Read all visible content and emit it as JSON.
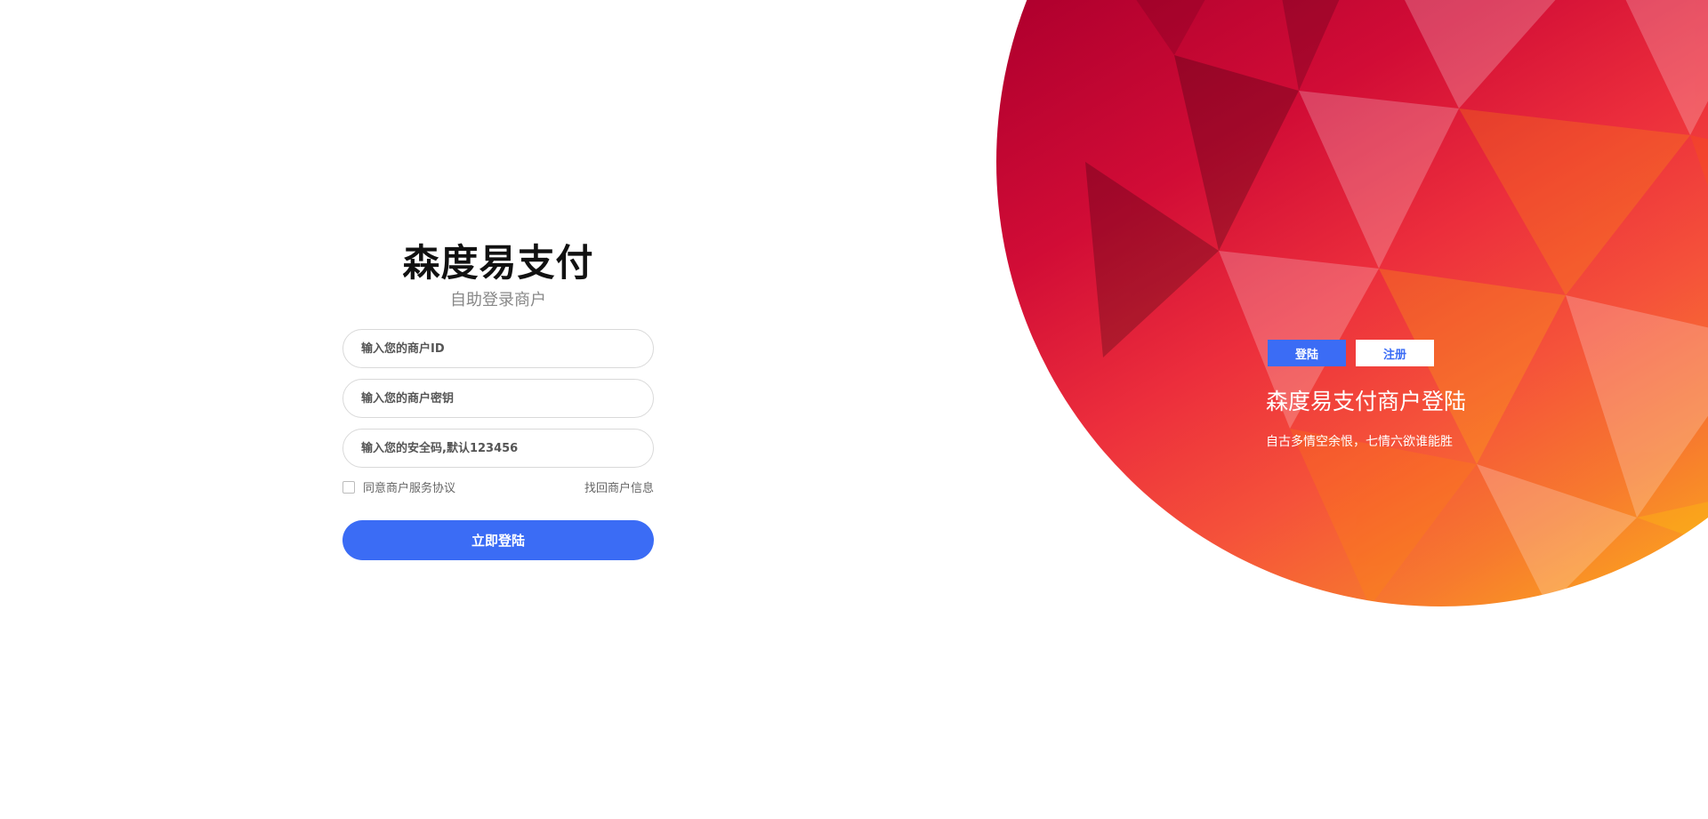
{
  "login": {
    "title": "森度易支付",
    "subtitle": "自助登录商户",
    "merchant_id_placeholder": "输入您的商户ID",
    "merchant_key_placeholder": "输入您的商户密钥",
    "security_code_placeholder": "输入您的安全码,默认123456",
    "agree_label": "同意商户服务协议",
    "recover_label": "找回商户信息",
    "submit_label": "立即登陆"
  },
  "hero": {
    "tab_login": "登陆",
    "tab_register": "注册",
    "title": "森度易支付商户登陆",
    "tagline": "自古多情空余恨，七情六欲谁能胜"
  },
  "colors": {
    "accent": "#3b6cf5",
    "hero_dark": "#7a0a2e",
    "hero_mid": "#ec2e3c",
    "hero_light": "#ffc80a"
  }
}
